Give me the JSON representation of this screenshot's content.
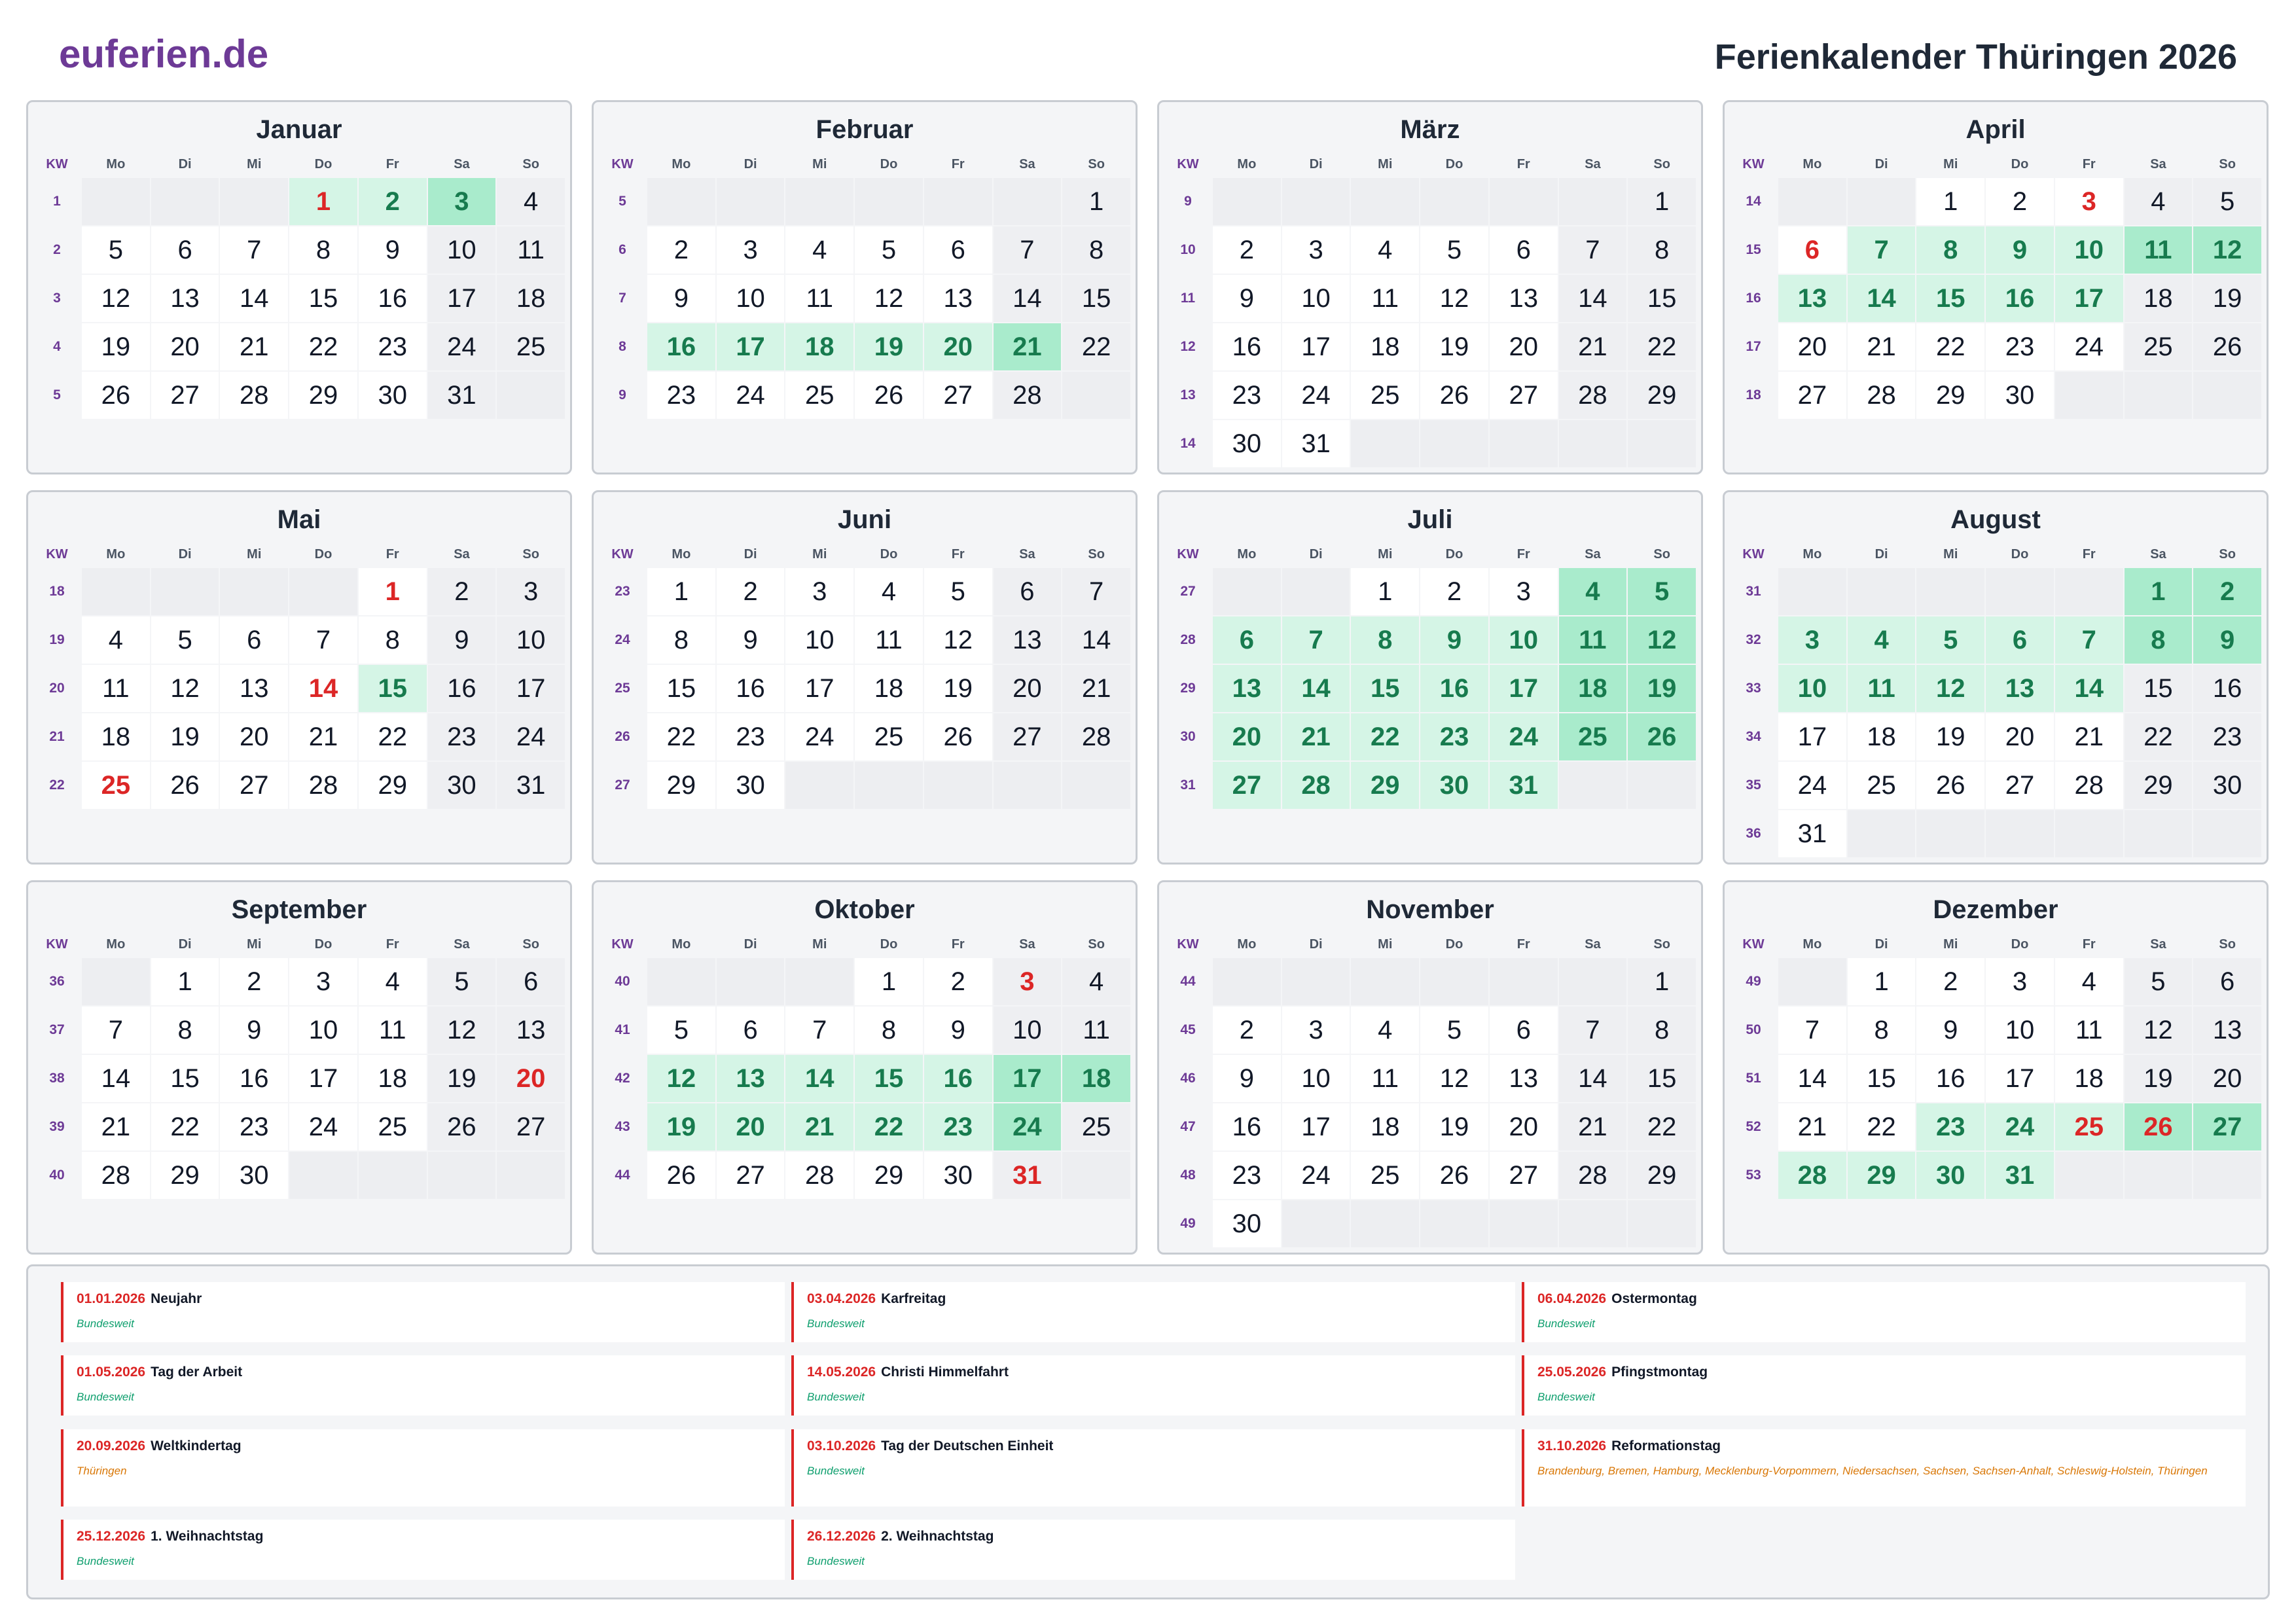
{
  "brand": "euferien.de",
  "title": "Ferienkalender Thüringen 2026",
  "colors": {
    "brand": "#6d3a96",
    "holiday_red": "#dc2626",
    "vacation_green_bg": "#d5f5e6",
    "vacation_green_weekend_bg": "#a9ebcc",
    "vacation_green_text": "#177b4e",
    "scope_green": "#0f9f6e",
    "scope_orange": "#d97706"
  },
  "weekday_header": {
    "kw": "KW",
    "days": [
      "Mo",
      "Di",
      "Mi",
      "Do",
      "Fr",
      "Sa",
      "So"
    ]
  },
  "months": [
    {
      "name": "Januar",
      "startWeekday": 3,
      "days": 31,
      "kw": [
        1,
        2,
        3,
        4,
        5,
        ""
      ],
      "vacation": [
        1,
        2,
        3
      ],
      "publicHolidays": [
        1
      ]
    },
    {
      "name": "Februar",
      "startWeekday": 6,
      "days": 28,
      "kw": [
        5,
        6,
        7,
        8,
        9,
        ""
      ],
      "vacation": [
        16,
        17,
        18,
        19,
        20,
        21
      ],
      "publicHolidays": []
    },
    {
      "name": "März",
      "startWeekday": 6,
      "days": 31,
      "kw": [
        9,
        10,
        11,
        12,
        13,
        14
      ],
      "vacation": [],
      "publicHolidays": []
    },
    {
      "name": "April",
      "startWeekday": 2,
      "days": 30,
      "kw": [
        14,
        15,
        16,
        17,
        18,
        ""
      ],
      "vacation": [
        7,
        8,
        9,
        10,
        11,
        12,
        13,
        14,
        15,
        16,
        17
      ],
      "publicHolidays": [
        3,
        6
      ]
    },
    {
      "name": "Mai",
      "startWeekday": 4,
      "days": 31,
      "kw": [
        18,
        19,
        20,
        21,
        22,
        ""
      ],
      "vacation": [
        15
      ],
      "publicHolidays": [
        1,
        14,
        25
      ]
    },
    {
      "name": "Juni",
      "startWeekday": 0,
      "days": 30,
      "kw": [
        23,
        24,
        25,
        26,
        27,
        ""
      ],
      "vacation": [],
      "publicHolidays": []
    },
    {
      "name": "Juli",
      "startWeekday": 2,
      "days": 31,
      "kw": [
        27,
        28,
        29,
        30,
        31,
        ""
      ],
      "vacation": [
        4,
        5,
        6,
        7,
        8,
        9,
        10,
        11,
        12,
        13,
        14,
        15,
        16,
        17,
        18,
        19,
        20,
        21,
        22,
        23,
        24,
        25,
        26,
        27,
        28,
        29,
        30,
        31
      ],
      "publicHolidays": []
    },
    {
      "name": "August",
      "startWeekday": 5,
      "days": 31,
      "kw": [
        31,
        32,
        33,
        34,
        35,
        36
      ],
      "vacation": [
        1,
        2,
        3,
        4,
        5,
        6,
        7,
        8,
        9,
        10,
        11,
        12,
        13,
        14
      ],
      "publicHolidays": []
    },
    {
      "name": "September",
      "startWeekday": 1,
      "days": 30,
      "kw": [
        36,
        37,
        38,
        39,
        40,
        ""
      ],
      "vacation": [],
      "publicHolidays": [
        20
      ]
    },
    {
      "name": "Oktober",
      "startWeekday": 3,
      "days": 31,
      "kw": [
        40,
        41,
        42,
        43,
        44,
        ""
      ],
      "vacation": [
        12,
        13,
        14,
        15,
        16,
        17,
        18,
        19,
        20,
        21,
        22,
        23,
        24
      ],
      "publicHolidays": [
        3,
        31
      ]
    },
    {
      "name": "November",
      "startWeekday": 6,
      "days": 30,
      "kw": [
        44,
        45,
        46,
        47,
        48,
        49
      ],
      "vacation": [],
      "publicHolidays": []
    },
    {
      "name": "Dezember",
      "startWeekday": 1,
      "days": 31,
      "kw": [
        49,
        50,
        51,
        52,
        53,
        ""
      ],
      "vacation": [
        23,
        24,
        25,
        26,
        27,
        28,
        29,
        30,
        31
      ],
      "publicHolidays": [
        25,
        26
      ]
    }
  ],
  "holidays": [
    {
      "date": "01.01.2026",
      "name": "Neujahr",
      "scope": "Bundesweit",
      "scope_color": "green"
    },
    {
      "date": "03.04.2026",
      "name": "Karfreitag",
      "scope": "Bundesweit",
      "scope_color": "green"
    },
    {
      "date": "06.04.2026",
      "name": "Ostermontag",
      "scope": "Bundesweit",
      "scope_color": "green"
    },
    {
      "date": "01.05.2026",
      "name": "Tag der Arbeit",
      "scope": "Bundesweit",
      "scope_color": "green"
    },
    {
      "date": "14.05.2026",
      "name": "Christi Himmelfahrt",
      "scope": "Bundesweit",
      "scope_color": "green"
    },
    {
      "date": "25.05.2026",
      "name": "Pfingstmontag",
      "scope": "Bundesweit",
      "scope_color": "green"
    },
    {
      "date": "20.09.2026",
      "name": "Weltkindertag",
      "scope": "Thüringen",
      "scope_color": "orange"
    },
    {
      "date": "03.10.2026",
      "name": "Tag der Deutschen Einheit",
      "scope": "Bundesweit",
      "scope_color": "green"
    },
    {
      "date": "31.10.2026",
      "name": "Reformationstag",
      "scope": "Brandenburg, Bremen, Hamburg, Mecklenburg-Vorpommern, Niedersachsen, Sachsen, Sachsen-Anhalt, Schleswig-Holstein, Thüringen",
      "scope_color": "orange"
    },
    {
      "date": "25.12.2026",
      "name": "1. Weihnachtstag",
      "scope": "Bundesweit",
      "scope_color": "green"
    },
    {
      "date": "26.12.2026",
      "name": "2. Weihnachtstag",
      "scope": "Bundesweit",
      "scope_color": "green"
    }
  ]
}
